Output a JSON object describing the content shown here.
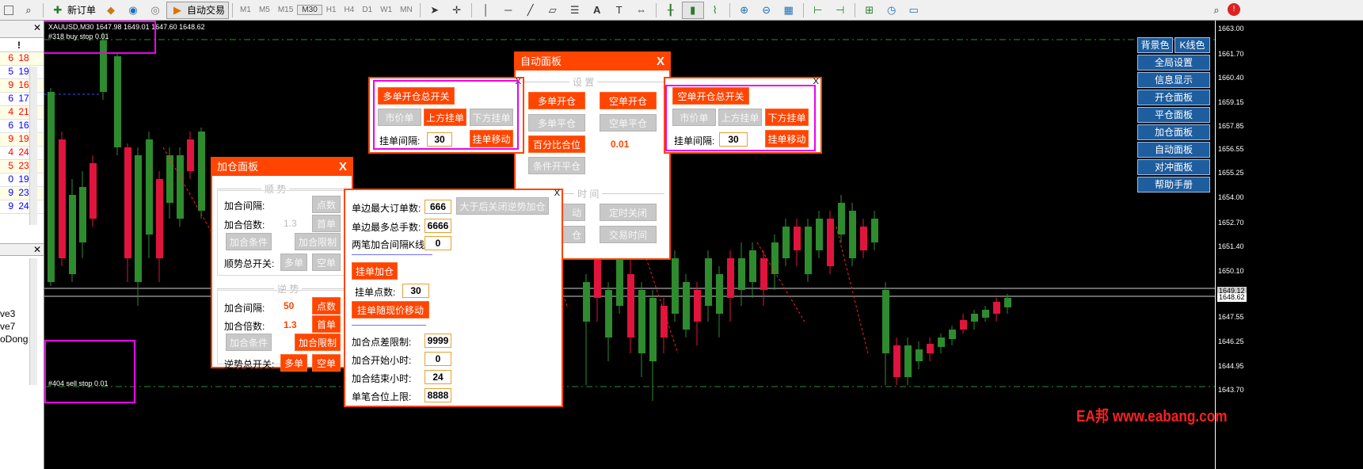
{
  "toolbar": {
    "new_order": "新订单",
    "auto_trade": "自动交易",
    "timeframes": [
      "M1",
      "M5",
      "M15",
      "M30",
      "H1",
      "H4",
      "D1",
      "W1",
      "MN"
    ],
    "active_timeframe": "M30"
  },
  "market_watch": {
    "rows": [
      {
        "a": "6",
        "b": "18",
        "ca": "#ff0000",
        "cb": "#ff0000"
      },
      {
        "a": "5",
        "b": "19",
        "ca": "#0000ff",
        "cb": "#0000ff"
      },
      {
        "a": "9",
        "b": "16",
        "ca": "#ff0000",
        "cb": "#ff0000"
      },
      {
        "a": "6",
        "b": "17",
        "ca": "#0000ff",
        "cb": "#0000ff"
      },
      {
        "a": "4",
        "b": "21",
        "ca": "#ff0000",
        "cb": "#ff0000"
      },
      {
        "a": "6",
        "b": "16",
        "ca": "#0000ff",
        "cb": "#0000ff"
      },
      {
        "a": "9",
        "b": "19",
        "ca": "#ff0000",
        "cb": "#ff0000"
      },
      {
        "a": "4",
        "b": "24",
        "ca": "#ff0000",
        "cb": "#ff0000"
      },
      {
        "a": "5",
        "b": "23",
        "ca": "#ff0000",
        "cb": "#ff0000"
      },
      {
        "a": "0",
        "b": "19",
        "ca": "#0000ff",
        "cb": "#0000ff"
      },
      {
        "a": "9",
        "b": "23",
        "ca": "#0000ff",
        "cb": "#0000ff"
      },
      {
        "a": "9",
        "b": "24",
        "ca": "#0000ff",
        "cb": "#0000ff"
      }
    ]
  },
  "navigator": {
    "items": [
      "ve3",
      "ve7",
      "oDong"
    ]
  },
  "chart": {
    "title": "XAUUSD,M30  1647.98 1649.01 1647.60 1648.62",
    "buy_stop": "#318 buy stop 0.01",
    "sell_stop": "#404 sell stop 0.01",
    "price_ticks": [
      "1663.00",
      "1661.70",
      "1660.40",
      "1659.15",
      "1657.85",
      "1656.55",
      "1655.25",
      "1654.00",
      "1652.70",
      "1651.40",
      "1650.10",
      "1649.12",
      "1648.62",
      "1647.55",
      "1646.25",
      "1644.95",
      "1643.70"
    ],
    "current_bid": "1648.62",
    "current_ask": "1649.12",
    "watermark": "EA邦 www.eabang.com",
    "colors": {
      "bull": "#2e8b2e",
      "bear": "#e0143c",
      "level": "#2e8b2e"
    }
  },
  "right_menu": {
    "bg_color": "背景色",
    "candle_color": "K线色",
    "items": [
      "全局设置",
      "信息显示",
      "开仓面板",
      "平仓面板",
      "加仓面板",
      "自动面板",
      "对冲面板",
      "帮助手册"
    ]
  },
  "auto_panel": {
    "title": "自动面板",
    "close": "X",
    "section_settings": "设 置",
    "long_open": "多单开仓",
    "short_open": "空单开仓",
    "long_close": "多单平仓",
    "short_close": "空单平仓",
    "pct_close": "百分比合位",
    "pct_value": "0.01",
    "cond_close": "条件开平仓",
    "section_time": "时 间",
    "b1": "动",
    "b2": "定时关闭",
    "b3": "仓",
    "b4": "交易时间"
  },
  "long_popup": {
    "x": "X",
    "master": "多单开仓总开关",
    "market": "市价单",
    "upper": "上方挂单",
    "lower": "下方挂单",
    "interval_label": "挂单间隔:",
    "interval_value": "30",
    "move": "挂单移动"
  },
  "short_popup": {
    "x": "X",
    "master": "空单开仓总开关",
    "market": "市价单",
    "upper": "上方挂单",
    "lower": "下方挂单",
    "interval_label": "挂单间隔:",
    "interval_value": "30",
    "move": "挂单移动"
  },
  "add_panel": {
    "title": "加仓面板",
    "close": "X",
    "trend_section": "顺 势",
    "interval_label": "加合间隔:",
    "mult_label": "加合倍数:",
    "interval_btn": "点数",
    "mult_btn": "首单",
    "cond_btn": "加合条件",
    "limit_btn": "加合限制",
    "trend_switch_label": "顺势总开关:",
    "long_btn": "多单",
    "short_btn": "空单",
    "trend_mult_value": "1.3",
    "counter_section": "逆 势",
    "ct_interval_label": "加合间隔:",
    "ct_interval_value": "50",
    "ct_mult_label": "加合倍数:",
    "ct_mult_value": "1.3",
    "ct_points_btn": "点数",
    "ct_first_btn": "首单",
    "ct_cond_btn": "加合条件",
    "ct_limit_btn": "加合限制",
    "ct_switch_label": "逆势总开关:",
    "ct_long": "多单",
    "ct_short": "空单"
  },
  "limit_popup": {
    "x": "X",
    "max_orders_label": "单边最大订单数:",
    "max_orders": "666",
    "max_lots_label": "单边最多总手数:",
    "max_lots": "6666",
    "k_interval_label": "两笔加合间隔K线:",
    "k_interval": "0",
    "close_btn": "大于后关闭逆势加仓",
    "pending_add": "挂单加仓",
    "pending_pts_label": "挂单点数:",
    "pending_pts": "30",
    "follow_btn": "挂单随现价移动",
    "spread_label": "加合点差限制:",
    "spread": "9999",
    "start_hour_label": "加合开始小时:",
    "start_hour": "0",
    "end_hour_label": "加合结束小时:",
    "end_hour": "24",
    "max_pos_label": "单笔合位上限:",
    "max_pos": "8888"
  }
}
